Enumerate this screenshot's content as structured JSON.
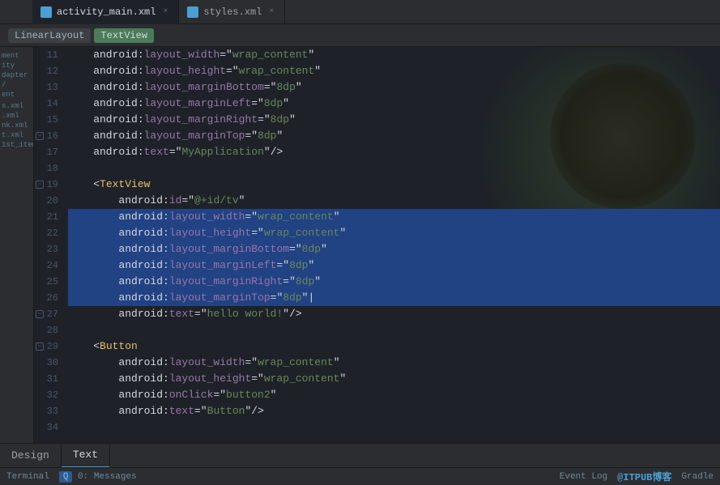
{
  "tabs": [
    {
      "id": "activity_main",
      "label": "activity_main.xml",
      "active": true
    },
    {
      "id": "styles",
      "label": "styles.xml",
      "active": false
    }
  ],
  "breadcrumbs": [
    {
      "id": "linearlayout",
      "label": "LinearLayout"
    },
    {
      "id": "textview",
      "label": "TextView"
    }
  ],
  "sidebar_items": [
    {
      "label": "ment"
    },
    {
      "label": "ity"
    },
    {
      "label": "dapter"
    },
    {
      "label": "/"
    },
    {
      "label": "ent"
    },
    {
      "label": ""
    },
    {
      "label": "s.xml"
    },
    {
      "label": ".xml"
    },
    {
      "label": "nk.xml"
    },
    {
      "label": "t.xml"
    },
    {
      "label": "ist_item"
    }
  ],
  "lines": [
    {
      "num": 11,
      "content": "    android:layout_width=\"wrap_content\"",
      "selected": false,
      "has_fold": false
    },
    {
      "num": 12,
      "content": "    android:layout_height=\"wrap_content\"",
      "selected": false,
      "has_fold": false
    },
    {
      "num": 13,
      "content": "    android:layout_marginBottom=\"8dp\"",
      "selected": false,
      "has_fold": false
    },
    {
      "num": 14,
      "content": "    android:layout_marginLeft=\"8dp\"",
      "selected": false,
      "has_fold": false
    },
    {
      "num": 15,
      "content": "    android:layout_marginRight=\"8dp\"",
      "selected": false,
      "has_fold": false
    },
    {
      "num": 16,
      "content": "    android:layout_marginTop=\"8dp\"",
      "selected": false,
      "has_fold": true
    },
    {
      "num": 17,
      "content": "    android:text=\"MyApplication\"/>",
      "selected": false,
      "has_fold": false
    },
    {
      "num": 18,
      "content": "",
      "selected": false,
      "has_fold": false
    },
    {
      "num": 19,
      "content": "    <TextView",
      "selected": false,
      "has_fold": true
    },
    {
      "num": 20,
      "content": "        android:id=\"@+id/tv\"",
      "selected": false,
      "has_fold": false
    },
    {
      "num": 21,
      "content": "        android:layout_width=\"wrap_content\"",
      "selected": true,
      "has_fold": false
    },
    {
      "num": 22,
      "content": "        android:layout_height=\"wrap_content\"",
      "selected": true,
      "has_fold": false
    },
    {
      "num": 23,
      "content": "        android:layout_marginBottom=\"8dp\"",
      "selected": true,
      "has_fold": false
    },
    {
      "num": 24,
      "content": "        android:layout_marginLeft=\"8dp\"",
      "selected": true,
      "has_fold": false
    },
    {
      "num": 25,
      "content": "        android:layout_marginRight=\"8dp\"",
      "selected": true,
      "has_fold": false
    },
    {
      "num": 26,
      "content": "        android:layout_marginTop=\"8dp\"|",
      "selected": true,
      "has_fold": false
    },
    {
      "num": 27,
      "content": "        android:text=\"hello world!\"/>",
      "selected": false,
      "has_fold": true
    },
    {
      "num": 28,
      "content": "",
      "selected": false,
      "has_fold": false
    },
    {
      "num": 29,
      "content": "    <Button",
      "selected": false,
      "has_fold": true
    },
    {
      "num": 30,
      "content": "        android:layout_width=\"wrap_content\"",
      "selected": false,
      "has_fold": false
    },
    {
      "num": 31,
      "content": "        android:layout_height=\"wrap_content\"",
      "selected": false,
      "has_fold": false
    },
    {
      "num": 32,
      "content": "        android:onClick=\"button2\"",
      "selected": false,
      "has_fold": false
    },
    {
      "num": 33,
      "content": "        android:text=\"Button\"/>",
      "selected": false,
      "has_fold": false
    },
    {
      "num": 34,
      "content": "",
      "selected": false,
      "has_fold": false
    }
  ],
  "bottom_tabs": [
    {
      "id": "design",
      "label": "Design",
      "active": false
    },
    {
      "id": "text",
      "label": "Text",
      "active": true
    }
  ],
  "status_left": [
    {
      "id": "terminal",
      "label": "Terminal"
    },
    {
      "id": "messages",
      "label": "0: Messages",
      "has_badge": true
    }
  ],
  "status_right": [
    {
      "id": "event_log",
      "label": "Event Log"
    },
    {
      "id": "gradle",
      "label": "Gradle"
    }
  ],
  "branding": "@ITPUB博客"
}
